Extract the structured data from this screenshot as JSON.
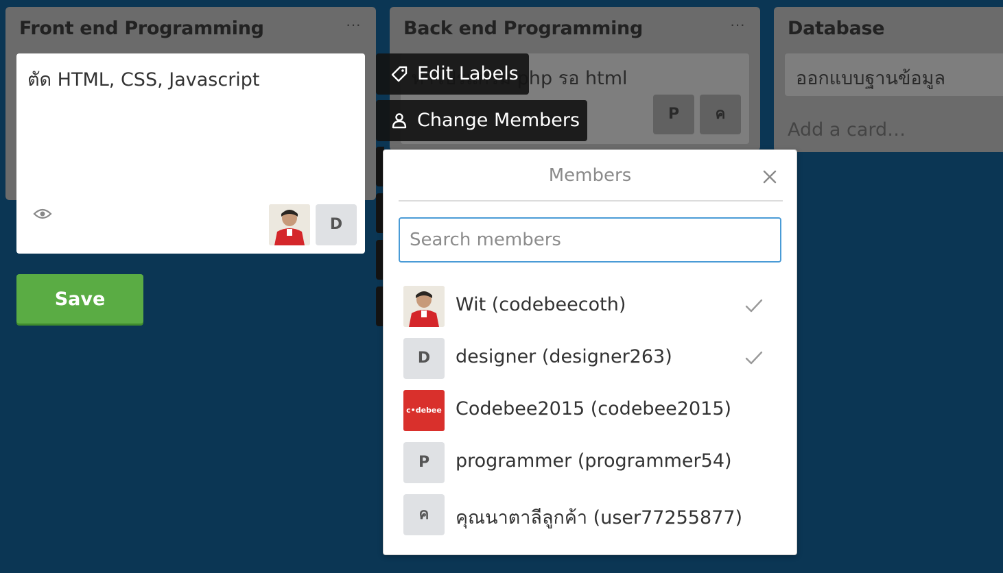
{
  "lists": [
    {
      "title": "Front end Programming",
      "menu": "···"
    },
    {
      "title": "Back end Programming",
      "menu": "···",
      "card_text": "ทำโปรแกรม php รอ html",
      "card_members": [
        "P",
        "ค"
      ]
    },
    {
      "title": "Database",
      "card_text": "ออกแบบฐานข้อมูล",
      "add_card": "Add a card…"
    }
  ],
  "edit_card": {
    "text": "ตัด HTML, CSS, Javascript",
    "avatar_letter": "D",
    "save_label": "Save"
  },
  "quick_actions": {
    "edit_labels": "Edit Labels",
    "change_members": "Change Members"
  },
  "members_popover": {
    "title": "Members",
    "search_placeholder": "Search members",
    "members": [
      {
        "name": "Wit (codebeecoth)",
        "avatar": "photo",
        "selected": true
      },
      {
        "name": "designer (designer263)",
        "avatar": "D",
        "selected": true
      },
      {
        "name": "Codebee2015 (codebee2015)",
        "avatar": "logo",
        "logo_text": "c•debee",
        "selected": false
      },
      {
        "name": "programmer (programmer54)",
        "avatar": "P",
        "selected": false
      },
      {
        "name": "คุณนาตาลีลูกค้า (user77255877)",
        "avatar": "ค",
        "selected": false
      }
    ]
  },
  "colors": {
    "board_bg": "#0b3654",
    "save_green": "#5aac44",
    "focus_blue": "#4a9bd6"
  }
}
